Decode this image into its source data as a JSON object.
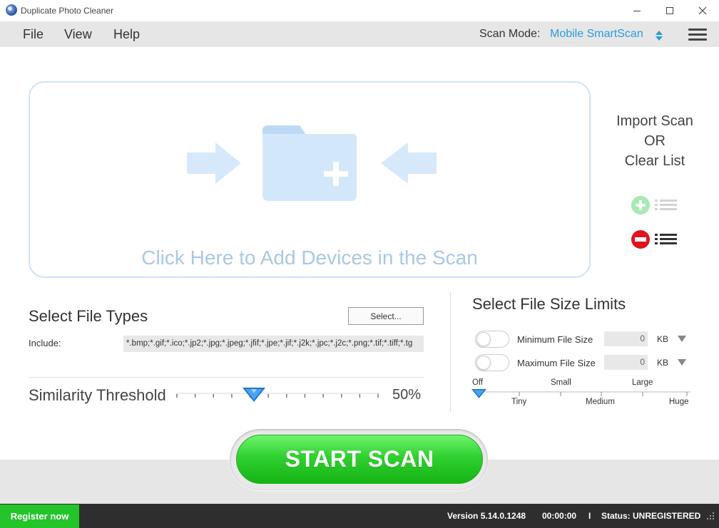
{
  "window": {
    "title": "Duplicate Photo Cleaner"
  },
  "menu": {
    "file": "File",
    "view": "View",
    "help": "Help"
  },
  "scan_mode": {
    "label": "Scan Mode:",
    "value": "Mobile SmartScan"
  },
  "dropzone": {
    "text": "Click Here to Add Devices in the Scan"
  },
  "import_panel": {
    "line1": "Import Scan",
    "line2": "OR",
    "line3": "Clear List"
  },
  "file_types": {
    "title": "Select File Types",
    "select_button": "Select...",
    "include_label": "Include:",
    "include_value": "*.bmp;*.gif;*.ico;*.jp2;*.jpg;*.jpeg;*.jfif;*.jpe;*.jif;*.j2k;*.jpc;*.j2c;*.png;*.tif;*.tiff;*.tg"
  },
  "similarity": {
    "title": "Similarity Threshold",
    "value_label": "50%",
    "level": 0.5
  },
  "file_size": {
    "title": "Select File Size Limits",
    "min": {
      "label": "Minimum File Size",
      "value": "0",
      "unit": "KB",
      "enabled": false
    },
    "max": {
      "label": "Maximum File Size",
      "value": "0",
      "unit": "KB",
      "enabled": false
    },
    "scale_top": [
      "Off",
      "Small",
      "Large"
    ],
    "scale_bottom": [
      "Tiny",
      "Medium",
      "Huge"
    ]
  },
  "start_scan": {
    "label": "START SCAN"
  },
  "status": {
    "register": "Register now",
    "version": "Version 5.14.0.1248",
    "time": "00:00:00",
    "separator": "I",
    "status": "Status: UNREGISTERED"
  },
  "colors": {
    "accent": "#2b9be0",
    "start_green": "#2fd02f",
    "register_green": "#23c52a",
    "dropzone_blue": "#cfe3f6",
    "clear_red": "#e0141e",
    "import_green": "#a6eab4"
  }
}
